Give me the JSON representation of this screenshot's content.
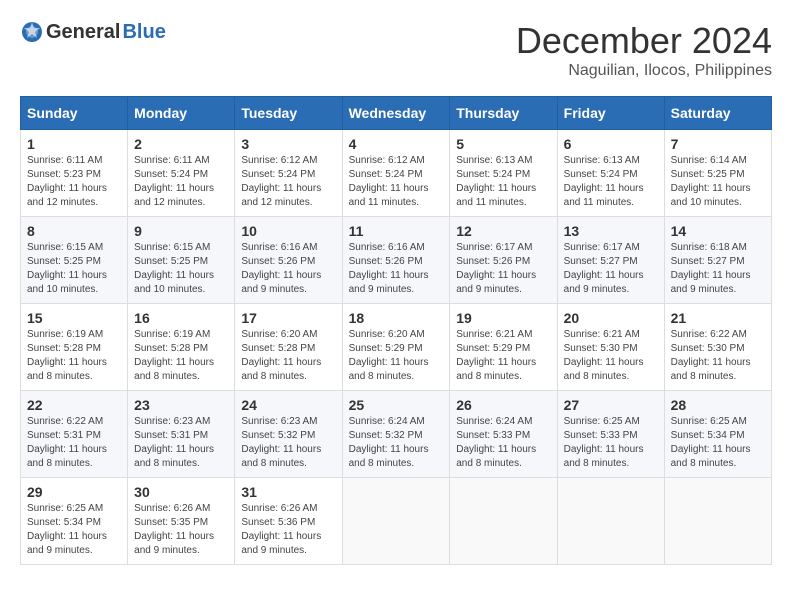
{
  "logo": {
    "general": "General",
    "blue": "Blue"
  },
  "header": {
    "month": "December 2024",
    "location": "Naguilian, Ilocos, Philippines"
  },
  "weekdays": [
    "Sunday",
    "Monday",
    "Tuesday",
    "Wednesday",
    "Thursday",
    "Friday",
    "Saturday"
  ],
  "weeks": [
    [
      {
        "day": "1",
        "info": "Sunrise: 6:11 AM\nSunset: 5:23 PM\nDaylight: 11 hours\nand 12 minutes."
      },
      {
        "day": "2",
        "info": "Sunrise: 6:11 AM\nSunset: 5:24 PM\nDaylight: 11 hours\nand 12 minutes."
      },
      {
        "day": "3",
        "info": "Sunrise: 6:12 AM\nSunset: 5:24 PM\nDaylight: 11 hours\nand 12 minutes."
      },
      {
        "day": "4",
        "info": "Sunrise: 6:12 AM\nSunset: 5:24 PM\nDaylight: 11 hours\nand 11 minutes."
      },
      {
        "day": "5",
        "info": "Sunrise: 6:13 AM\nSunset: 5:24 PM\nDaylight: 11 hours\nand 11 minutes."
      },
      {
        "day": "6",
        "info": "Sunrise: 6:13 AM\nSunset: 5:24 PM\nDaylight: 11 hours\nand 11 minutes."
      },
      {
        "day": "7",
        "info": "Sunrise: 6:14 AM\nSunset: 5:25 PM\nDaylight: 11 hours\nand 10 minutes."
      }
    ],
    [
      {
        "day": "8",
        "info": "Sunrise: 6:15 AM\nSunset: 5:25 PM\nDaylight: 11 hours\nand 10 minutes."
      },
      {
        "day": "9",
        "info": "Sunrise: 6:15 AM\nSunset: 5:25 PM\nDaylight: 11 hours\nand 10 minutes."
      },
      {
        "day": "10",
        "info": "Sunrise: 6:16 AM\nSunset: 5:26 PM\nDaylight: 11 hours\nand 9 minutes."
      },
      {
        "day": "11",
        "info": "Sunrise: 6:16 AM\nSunset: 5:26 PM\nDaylight: 11 hours\nand 9 minutes."
      },
      {
        "day": "12",
        "info": "Sunrise: 6:17 AM\nSunset: 5:26 PM\nDaylight: 11 hours\nand 9 minutes."
      },
      {
        "day": "13",
        "info": "Sunrise: 6:17 AM\nSunset: 5:27 PM\nDaylight: 11 hours\nand 9 minutes."
      },
      {
        "day": "14",
        "info": "Sunrise: 6:18 AM\nSunset: 5:27 PM\nDaylight: 11 hours\nand 9 minutes."
      }
    ],
    [
      {
        "day": "15",
        "info": "Sunrise: 6:19 AM\nSunset: 5:28 PM\nDaylight: 11 hours\nand 8 minutes."
      },
      {
        "day": "16",
        "info": "Sunrise: 6:19 AM\nSunset: 5:28 PM\nDaylight: 11 hours\nand 8 minutes."
      },
      {
        "day": "17",
        "info": "Sunrise: 6:20 AM\nSunset: 5:28 PM\nDaylight: 11 hours\nand 8 minutes."
      },
      {
        "day": "18",
        "info": "Sunrise: 6:20 AM\nSunset: 5:29 PM\nDaylight: 11 hours\nand 8 minutes."
      },
      {
        "day": "19",
        "info": "Sunrise: 6:21 AM\nSunset: 5:29 PM\nDaylight: 11 hours\nand 8 minutes."
      },
      {
        "day": "20",
        "info": "Sunrise: 6:21 AM\nSunset: 5:30 PM\nDaylight: 11 hours\nand 8 minutes."
      },
      {
        "day": "21",
        "info": "Sunrise: 6:22 AM\nSunset: 5:30 PM\nDaylight: 11 hours\nand 8 minutes."
      }
    ],
    [
      {
        "day": "22",
        "info": "Sunrise: 6:22 AM\nSunset: 5:31 PM\nDaylight: 11 hours\nand 8 minutes."
      },
      {
        "day": "23",
        "info": "Sunrise: 6:23 AM\nSunset: 5:31 PM\nDaylight: 11 hours\nand 8 minutes."
      },
      {
        "day": "24",
        "info": "Sunrise: 6:23 AM\nSunset: 5:32 PM\nDaylight: 11 hours\nand 8 minutes."
      },
      {
        "day": "25",
        "info": "Sunrise: 6:24 AM\nSunset: 5:32 PM\nDaylight: 11 hours\nand 8 minutes."
      },
      {
        "day": "26",
        "info": "Sunrise: 6:24 AM\nSunset: 5:33 PM\nDaylight: 11 hours\nand 8 minutes."
      },
      {
        "day": "27",
        "info": "Sunrise: 6:25 AM\nSunset: 5:33 PM\nDaylight: 11 hours\nand 8 minutes."
      },
      {
        "day": "28",
        "info": "Sunrise: 6:25 AM\nSunset: 5:34 PM\nDaylight: 11 hours\nand 8 minutes."
      }
    ],
    [
      {
        "day": "29",
        "info": "Sunrise: 6:25 AM\nSunset: 5:34 PM\nDaylight: 11 hours\nand 9 minutes."
      },
      {
        "day": "30",
        "info": "Sunrise: 6:26 AM\nSunset: 5:35 PM\nDaylight: 11 hours\nand 9 minutes."
      },
      {
        "day": "31",
        "info": "Sunrise: 6:26 AM\nSunset: 5:36 PM\nDaylight: 11 hours\nand 9 minutes."
      },
      {
        "day": "",
        "info": ""
      },
      {
        "day": "",
        "info": ""
      },
      {
        "day": "",
        "info": ""
      },
      {
        "day": "",
        "info": ""
      }
    ]
  ]
}
